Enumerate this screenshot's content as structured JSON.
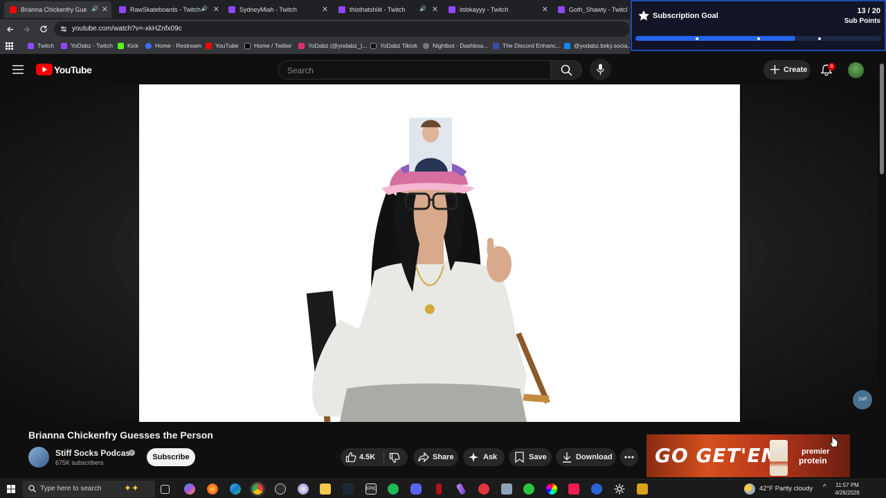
{
  "browser": {
    "tabs": [
      {
        "title": "Brianna Chickenfry Guesse",
        "favicon_color": "#ff0000",
        "active": true,
        "audio": true
      },
      {
        "title": "RawSkateboards - Twitch",
        "favicon_color": "#9146ff",
        "active": false,
        "audio": true
      },
      {
        "title": "SydneyMiah - Twitch",
        "favicon_color": "#9146ff",
        "active": false,
        "audio": false
      },
      {
        "title": "thisthatshiiit - Twitch",
        "favicon_color": "#9146ff",
        "active": false,
        "audio": true
      },
      {
        "title": "itsbkayyy - Twitch",
        "favicon_color": "#9146ff",
        "active": false,
        "audio": false
      },
      {
        "title": "Goth_Shawty - Twitch",
        "favicon_color": "#9146ff",
        "active": false,
        "audio": false
      }
    ],
    "url": "youtube.com/watch?v=-xkHZnfx09c",
    "bookmarks": [
      {
        "label": "Twitch",
        "icon_color": "#9146ff"
      },
      {
        "label": "YoDabz - Twitch",
        "icon_color": "#9146ff"
      },
      {
        "label": "Kick",
        "icon_color": "#53fc18"
      },
      {
        "label": "Home - Restream",
        "icon_color": "#3b6cff"
      },
      {
        "label": "YouTube",
        "icon_color": "#ff0000"
      },
      {
        "label": "Home / Twitter",
        "icon_color": "#000000"
      },
      {
        "label": "YoDabz (@yodabz_)...",
        "icon_color": "#e1306c"
      },
      {
        "label": "YoDabz Tiktok",
        "icon_color": "#111111"
      },
      {
        "label": "Nightbot - Dashboa...",
        "icon_color": "#555555"
      },
      {
        "label": "The Discord Enhanc...",
        "icon_color": "#3b4fa8"
      },
      {
        "label": "@yodabz.bsky.socia...",
        "icon_color": "#1185fe"
      }
    ]
  },
  "overlay": {
    "title": "Subscription Goal",
    "count": "13 / 20",
    "unit": "Sub Points",
    "progress": 0.65
  },
  "youtube": {
    "logo_text": "YouTube",
    "search_placeholder": "Search",
    "create_label": "Create",
    "notification_count": "8",
    "video_title": "Brianna Chickenfry Guesses the Person",
    "channel_name": "Stiff Socks Podcast",
    "subscribers": "675K subscribers",
    "subscribe_label": "Subscribe",
    "likes": "4.5K",
    "share_label": "Share",
    "ask_label": "Ask",
    "save_label": "Save",
    "download_label": "Download",
    "watermark": "Stiff"
  },
  "ad": {
    "headline": "GO GET'EM",
    "brand_line1": "premier",
    "brand_line2": "protein"
  },
  "taskbar": {
    "search_placeholder": "Type here to search",
    "weather": "42°F  Partly cloudy",
    "time": "11:57 PM",
    "date": "4/26/2026"
  }
}
